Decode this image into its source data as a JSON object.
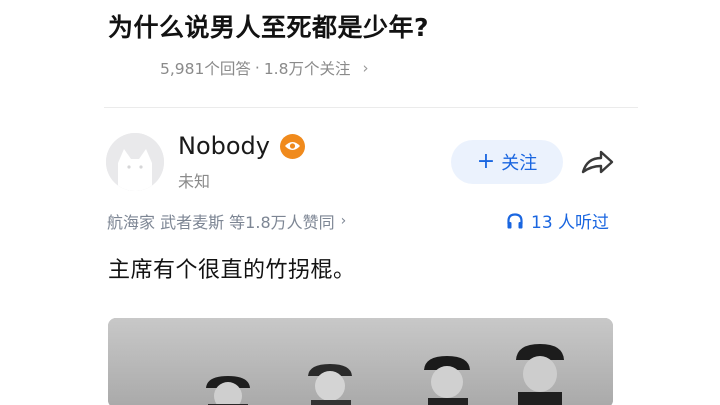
{
  "question": {
    "title": "为什么说男人至死都是少年?",
    "answers_count": "5,981个回答",
    "separator": "·",
    "followers_count": "1.8万个关注",
    "chevron": "›"
  },
  "author": {
    "name": "Nobody",
    "subtitle": "未知",
    "avatar_icon": "cat-avatar-icon",
    "badge_icon": "eye-badge-icon",
    "badge_color": "#f08a1c"
  },
  "actions": {
    "follow_plus": "+",
    "follow_label": "关注",
    "share_icon": "share-icon",
    "accent_color": "#1a66e0"
  },
  "engagement": {
    "likers_text": "航海家 武者麦斯 等1.8万人赞同",
    "chevron": "›",
    "listen_icon": "headphones-icon",
    "listen_text": "13 人听过"
  },
  "answer": {
    "text": "主席有个很直的竹拐棍。"
  }
}
